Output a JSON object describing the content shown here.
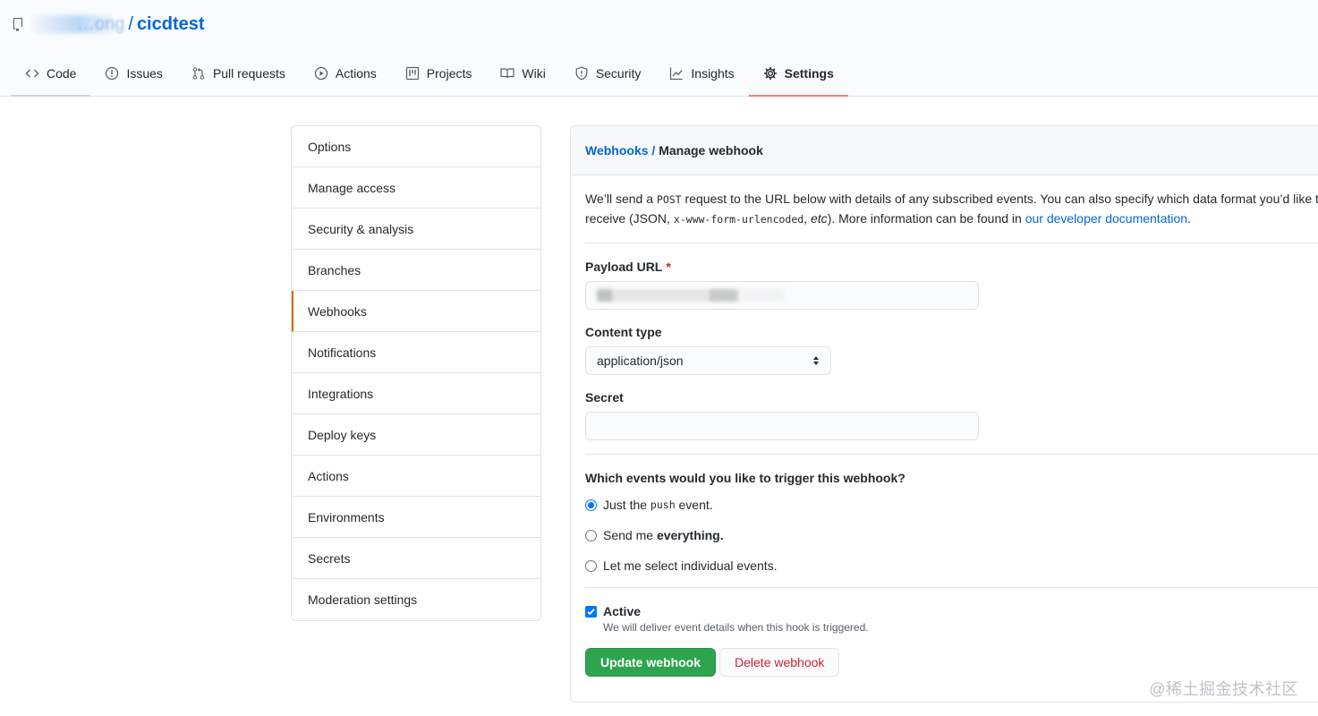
{
  "header": {
    "owner_name": "…ong",
    "separator": "/",
    "repo_name": "cicdtest",
    "tabs": [
      {
        "label": "Code",
        "icon": "code-icon"
      },
      {
        "label": "Issues",
        "icon": "issue-icon"
      },
      {
        "label": "Pull requests",
        "icon": "pull-request-icon"
      },
      {
        "label": "Actions",
        "icon": "play-icon"
      },
      {
        "label": "Projects",
        "icon": "project-icon"
      },
      {
        "label": "Wiki",
        "icon": "book-icon"
      },
      {
        "label": "Security",
        "icon": "shield-icon"
      },
      {
        "label": "Insights",
        "icon": "graph-icon"
      },
      {
        "label": "Settings",
        "icon": "gear-icon",
        "selected": true
      }
    ]
  },
  "menu": {
    "items": [
      "Options",
      "Manage access",
      "Security & analysis",
      "Branches",
      "Webhooks",
      "Notifications",
      "Integrations",
      "Deploy keys",
      "Actions",
      "Environments",
      "Secrets",
      "Moderation settings"
    ],
    "selected": "Webhooks"
  },
  "webhook": {
    "breadcrumb_link": "Webhooks",
    "breadcrumb_sep": " / ",
    "breadcrumb_current": "Manage webhook",
    "intro_1a": "We’ll send a ",
    "intro_1_code": "POST",
    "intro_1b": " request to the URL below with details of any subscribed events. You can also specify which data format you’d like to",
    "intro_2a": "receive (JSON, ",
    "intro_2_code": "x-www-form-urlencoded",
    "intro_2b": ", ",
    "intro_2_em": "etc",
    "intro_2c": "). More information can be found in ",
    "intro_2_link": "our developer documentation",
    "intro_2d": ".",
    "payload_label": "Payload URL",
    "required_mark": "*",
    "content_type_label": "Content type",
    "content_type_value": "application/json",
    "secret_label": "Secret",
    "secret_value": "",
    "events_question": "Which events would you like to trigger this webhook?",
    "radio_1a": "Just the ",
    "radio_1_code": "push",
    "radio_1b": " event.",
    "radio_2a": "Send me ",
    "radio_2_strong": "everything.",
    "radio_3": "Let me select individual events.",
    "selected_event": "push",
    "active_label": "Active",
    "active_checked": true,
    "active_note": "We will deliver event details when this hook is triggered.",
    "update_button": "Update webhook",
    "delete_button": "Delete webhook"
  },
  "watermark": "@稀土掘金技术社区",
  "colors": {
    "link": "#0366d6",
    "tab_underline": "#f9826c",
    "primary_button": "#2ea44f",
    "danger_text": "#cb2431",
    "required": "#cb2431"
  }
}
